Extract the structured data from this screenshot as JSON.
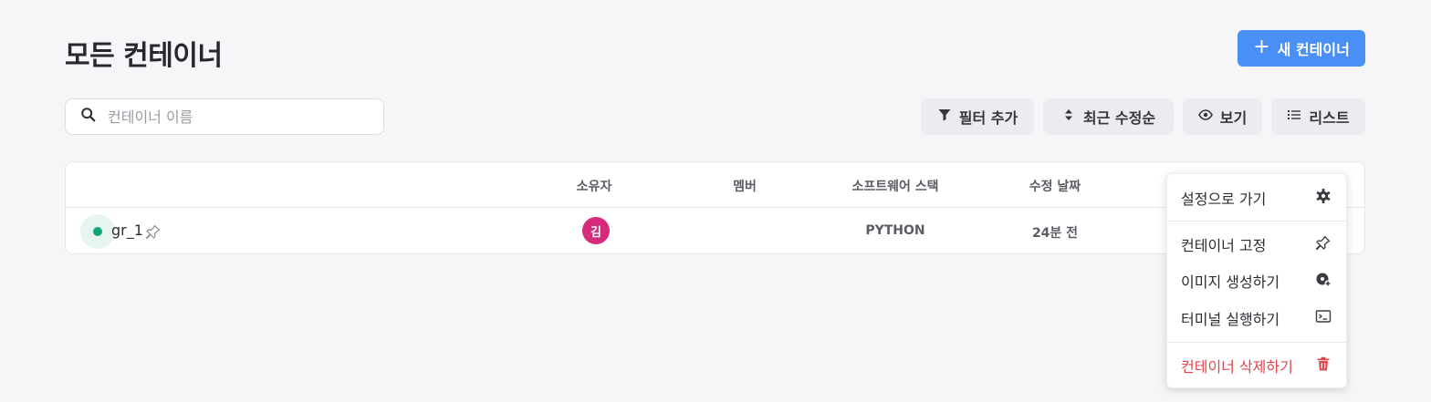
{
  "header": {
    "title": "모든 컨테이너",
    "new_button_label": "새 컨테이너"
  },
  "search": {
    "placeholder": "컨테이너 이름",
    "value": ""
  },
  "toolbar": {
    "filter_label": "필터 추가",
    "sort_label": "최근 수정순",
    "view_label": "보기",
    "list_label": "리스트"
  },
  "table": {
    "columns": [
      "소유자",
      "멤버",
      "소프트웨어 스택",
      "수정 날짜"
    ],
    "rows": [
      {
        "name": "gr_1",
        "owner_initial": "김",
        "members": "",
        "stack": "PYTHON",
        "modified": "24분 전",
        "status_color": "#14a67a"
      }
    ]
  },
  "context_menu": {
    "items": [
      {
        "label": "설정으로 가기",
        "icon": "gear-icon"
      },
      {
        "label": "컨테이너 고정",
        "icon": "pin-icon"
      },
      {
        "label": "이미지 생성하기",
        "icon": "disc-plus-icon"
      },
      {
        "label": "터미널 실행하기",
        "icon": "terminal-icon"
      },
      {
        "label": "컨테이너 삭제하기",
        "icon": "trash-icon"
      }
    ]
  },
  "colors": {
    "accent": "#4a8ff5",
    "danger": "#e0474d",
    "avatar": "#d62a7a",
    "status_running": "#14a67a"
  }
}
